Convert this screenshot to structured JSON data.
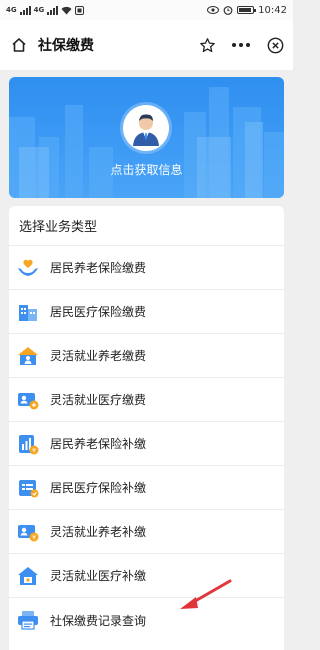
{
  "status_bar": {
    "signal_1": "4G",
    "signal_2": "4G",
    "time": "10:42"
  },
  "nav": {
    "title": "社保缴费",
    "icons": [
      "home-icon",
      "star-icon",
      "more-icon",
      "close-icon"
    ]
  },
  "banner": {
    "text": "点击获取信息",
    "background": "#3a97f4"
  },
  "section": {
    "title": "选择业务类型"
  },
  "services": [
    {
      "label": "居民养老保险缴费",
      "icon": "hands-heart-icon"
    },
    {
      "label": "居民医疗保险缴费",
      "icon": "hospital-building-icon"
    },
    {
      "label": "灵活就业养老缴费",
      "icon": "house-person-icon"
    },
    {
      "label": "灵活就业医疗缴费",
      "icon": "card-person-icon"
    },
    {
      "label": "居民养老保险补缴",
      "icon": "chart-coin-icon"
    },
    {
      "label": "居民医疗保险补缴",
      "icon": "list-card-icon"
    },
    {
      "label": "灵活就业养老补缴",
      "icon": "card-coin-icon"
    },
    {
      "label": "灵活就业医疗补缴",
      "icon": "house-card-icon"
    },
    {
      "label": "社保缴费记录查询",
      "icon": "printer-icon"
    }
  ],
  "colors": {
    "accent_blue": "#2f8ff0",
    "icon_orange": "#f5a623",
    "arrow_red": "#e0353b"
  }
}
